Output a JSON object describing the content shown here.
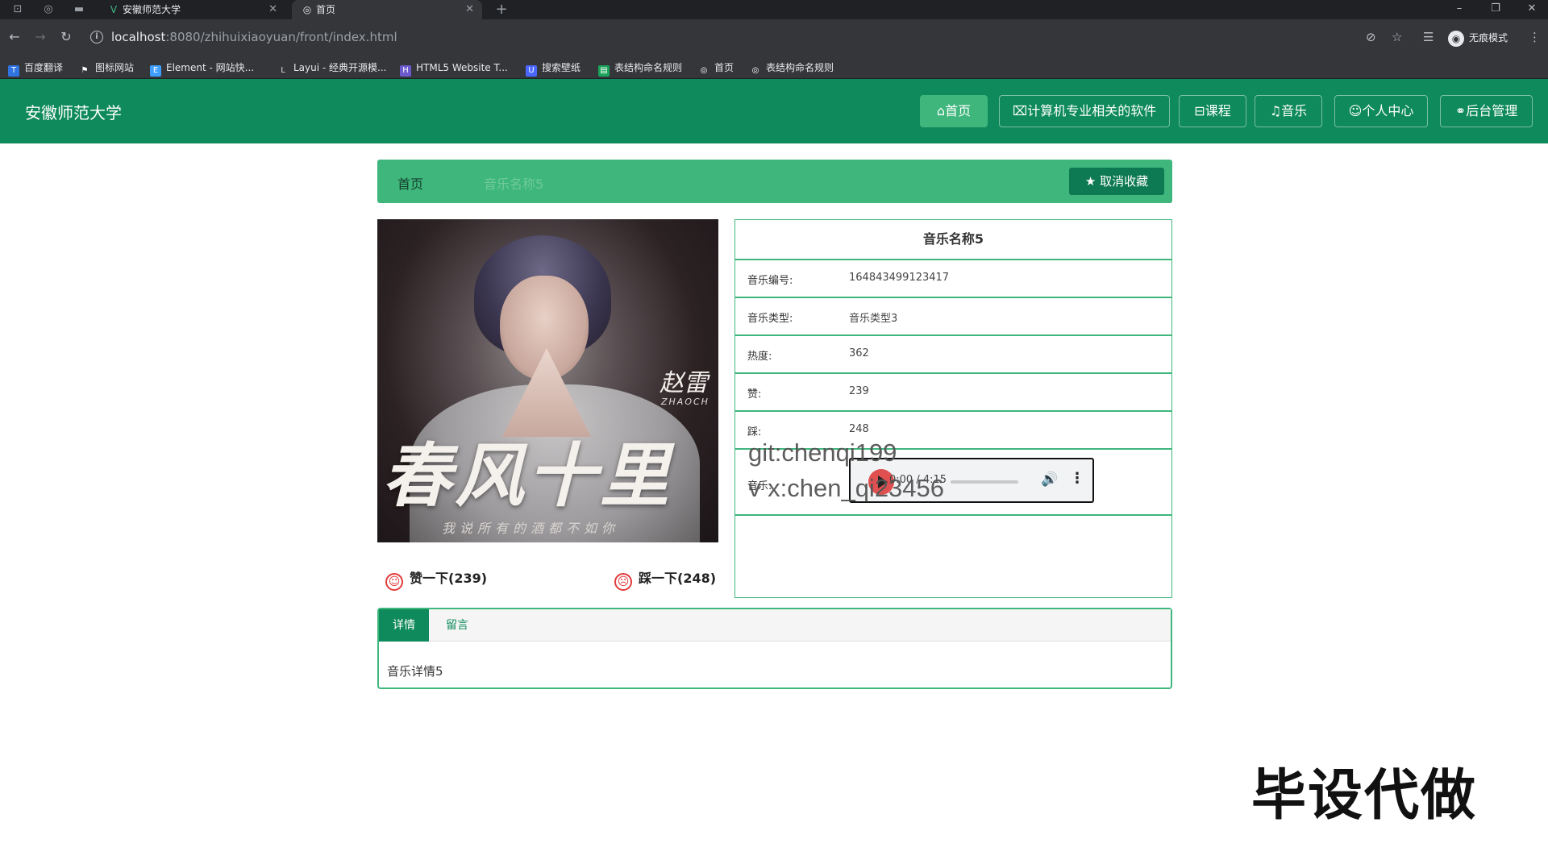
{
  "browser": {
    "tabs": [
      {
        "title": "安徽师范大学",
        "active": false
      },
      {
        "title": "首页",
        "active": true
      }
    ],
    "url_host": "localhost",
    "url_path": ":8080/zhihuixiaoyuan/front/index.html",
    "profile_label": "无痕模式",
    "bookmarks": [
      {
        "label": "百度翻译",
        "color": "#2f74e0"
      },
      {
        "label": "图标网站",
        "color": "#ffffff"
      },
      {
        "label": "Element - 网站快...",
        "color": "#409eff"
      },
      {
        "label": "Layui - 经典开源模...",
        "color": "#dddddd"
      },
      {
        "label": "HTML5 Website T...",
        "color": "#6a5acd"
      },
      {
        "label": "搜索壁纸",
        "color": "#4a67ff"
      },
      {
        "label": "表结构命名规则",
        "color": "#1aa35a"
      },
      {
        "label": "首页",
        "color": "#ffffff"
      },
      {
        "label": "表结构命名规则",
        "color": "#ffffff"
      }
    ]
  },
  "header": {
    "site_title": "安徽师范大学",
    "nav": [
      {
        "icon": "home-icon",
        "glyph": "⌂",
        "label": "首页",
        "active": true
      },
      {
        "icon": "code-icon",
        "glyph": "⌧",
        "label": "计算机专业相关的软件",
        "active": false
      },
      {
        "icon": "book-icon",
        "glyph": "⊟",
        "label": "课程",
        "active": false
      },
      {
        "icon": "music-icon",
        "glyph": "♫",
        "label": "音乐",
        "active": false
      },
      {
        "icon": "user-icon",
        "glyph": "☺",
        "label": "个人中心",
        "active": false
      },
      {
        "icon": "link-icon",
        "glyph": "⚭",
        "label": "后台管理",
        "active": false
      }
    ],
    "colors": {
      "primary": "#0e8a5c",
      "accent": "#3fb67c"
    }
  },
  "breadcrumb": {
    "home": "首页",
    "current": "音乐名称5",
    "favorite_button": "取消收藏"
  },
  "album": {
    "cover_title": "春风十里",
    "cover_artist": "赵雷",
    "cover_artist_en": "ZHAOCH",
    "cover_lyric": "我说所有的酒都不如你"
  },
  "votes": {
    "like_label": "赞一下(239)",
    "dislike_label": "踩一下(248)"
  },
  "detail": {
    "title": "音乐名称5",
    "rows": [
      {
        "key": "音乐编号:",
        "value": "164843499123417"
      },
      {
        "key": "音乐类型:",
        "value": "音乐类型3"
      },
      {
        "key": "热度:",
        "value": "362"
      },
      {
        "key": "赞:",
        "value": "239"
      },
      {
        "key": "踩:",
        "value": "248"
      }
    ],
    "audio_label": "音乐:",
    "player_time": "0:00 / 4:15"
  },
  "watermarks": {
    "line1": "git:chenqi199",
    "line2": "v x:chen_qi23456",
    "corner": "毕设代做"
  },
  "tabs": {
    "items": [
      "详情",
      "留言"
    ],
    "content": "音乐详情5"
  }
}
